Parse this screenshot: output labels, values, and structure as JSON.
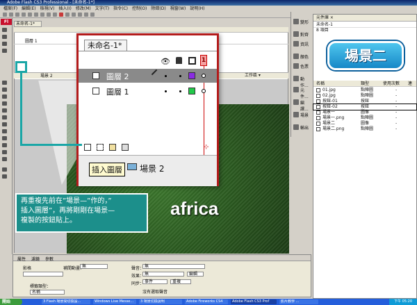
{
  "window": {
    "title": "Adobe Flash CS3 Professional - [未命名-1*]"
  },
  "menu": [
    "檔案(F)",
    "編輯(E)",
    "檢視(V)",
    "插入(I)",
    "修改(M)",
    "文字(T)",
    "指令(C)",
    "控制(O)",
    "除錯(D)",
    "視窗(W)",
    "說明(H)"
  ],
  "tools": {
    "logo": "Fl"
  },
  "document": {
    "tab": "未命名-1*",
    "small_layers": [
      "圖層 1"
    ],
    "small_scene": "場景 2",
    "workspace": "工作區 ▾",
    "stage_text": "africa"
  },
  "zoom": {
    "tab": "未命名-1*",
    "frame_number": "1",
    "layers": [
      {
        "name": "圖層 2",
        "color": "#8a2be2",
        "selected": true
      },
      {
        "name": "圖層 1",
        "color": "#22c94a",
        "selected": false
      }
    ],
    "scene_label": "場景 2",
    "tooltip": "插入圖層"
  },
  "note": {
    "text": "再重複先前在”場景—”作的，”\n插入圖層”，再將剛剛在場景—\n複製的按鈕貼上。"
  },
  "side_panel": {
    "items": [
      "變形",
      "對齊",
      "資訊",
      "顏色",
      "色票",
      "動作...",
      "元件...",
      "編譯...",
      "場景",
      "輸出"
    ]
  },
  "library": {
    "header": "元件庫 ×",
    "doc": "未命名-1",
    "count": "8 項目",
    "preview_text": "場景二",
    "columns": [
      "名稱",
      "類型",
      "使用次數",
      "連"
    ],
    "items": [
      {
        "name": "01.jpg",
        "type": "點陣圖",
        "uses": "-"
      },
      {
        "name": "02.jpg",
        "type": "點陣圖",
        "uses": "-"
      },
      {
        "name": "按鈕-01",
        "type": "按鈕",
        "uses": "-"
      },
      {
        "name": "按鈕-02",
        "type": "按鈕",
        "uses": "-"
      },
      {
        "name": "場景一",
        "type": "圖像",
        "uses": "-"
      },
      {
        "name": "場景一.png",
        "type": "點陣圖",
        "uses": "-"
      },
      {
        "name": "場景二",
        "type": "圖像",
        "uses": "-"
      },
      {
        "name": "場景二.png",
        "type": "點陣圖",
        "uses": "-"
      }
    ]
  },
  "properties": {
    "tabs": [
      "屬性",
      "濾鏡",
      "參數"
    ],
    "shape_label": "影格",
    "tween_label": "補間動畫：",
    "tween_value": "無",
    "sound_label": "聲音：",
    "sound_value": "無",
    "effect_label": "效果：",
    "effect_value": "無",
    "edit_button": "編輯",
    "sync_label": "同步：",
    "sync_value": "事件",
    "repeat_value": "重複",
    "no_sound": "沒有選取聲音",
    "label_type": "標籤類型：",
    "label_value": "名稱"
  },
  "taskbar": {
    "start": "開始",
    "tasks": [
      "3 Flash 場景間切換設...",
      "Windows Live Messe...",
      "3 場景切換說明",
      "Adobe Fireworks CS4",
      "Adobe Flash CS3 Prof",
      "影片教學 ..."
    ],
    "clock": "下午 05:20"
  }
}
